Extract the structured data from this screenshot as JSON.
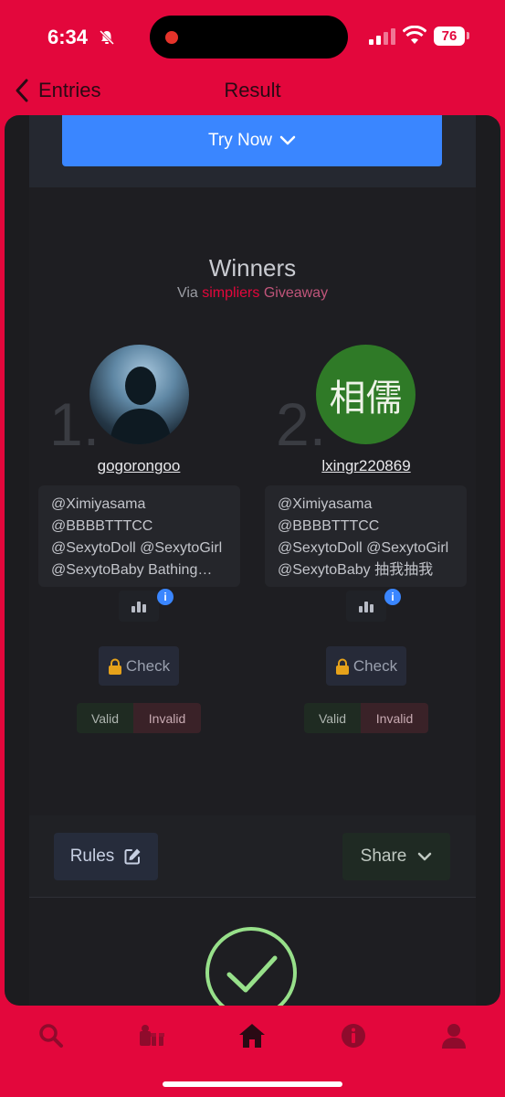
{
  "status": {
    "time": "6:34",
    "battery": "76"
  },
  "nav": {
    "back_label": "Entries",
    "title": "Result"
  },
  "try_button": {
    "label": "Try Now"
  },
  "winners": {
    "title": "Winners",
    "via_prefix": "Via",
    "brand": "simpliers",
    "suffix": "Giveaway",
    "list": [
      {
        "rank": "1.",
        "username": "gogorongoo",
        "tags": [
          "@Ximiyasama",
          "@BBBBTTTCC",
          "@SexytoDoll @SexytoGirl",
          "@SexytoBaby Bathing…"
        ]
      },
      {
        "rank": "2.",
        "username": "lxingr220869",
        "avatar_text": "相儒",
        "tags": [
          "@Ximiyasama",
          "@BBBBTTTCC",
          "@SexytoDoll @SexytoGirl",
          "@SexytoBaby 抽我抽我"
        ]
      }
    ],
    "info_glyph": "i",
    "check_label": "Check",
    "valid_label": "Valid",
    "invalid_label": "Invalid"
  },
  "footer": {
    "rules_label": "Rules",
    "share_label": "Share"
  },
  "colors": {
    "brand": "#e3073c",
    "accent_blue": "#3a86ff",
    "success_green": "#97e08a"
  },
  "tabbar": {
    "icons": [
      "search-icon",
      "gifts-icon",
      "home-icon",
      "info-icon",
      "profile-icon"
    ]
  }
}
